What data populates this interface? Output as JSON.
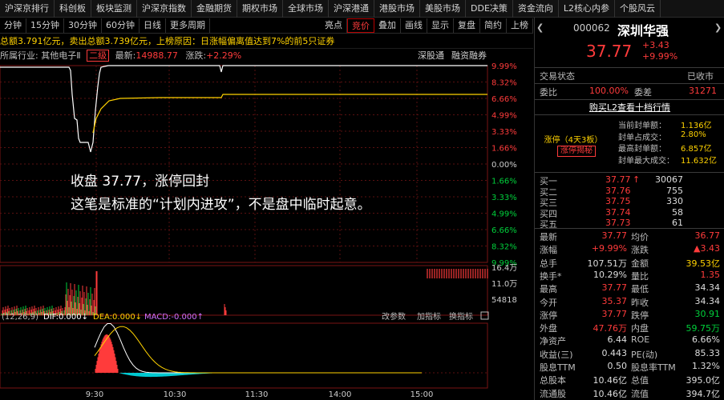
{
  "topnav": [
    "沪深京排行",
    "科创板",
    "板块监测",
    "沪深京指数",
    "金融期货",
    "期权市场",
    "全球市场",
    "沪深港通",
    "港股市场",
    "美股市场",
    "DDE决策",
    "资金流向",
    "L2核心内参",
    "个股风云"
  ],
  "toolbar": {
    "left": [
      "分钟",
      "15分钟",
      "30分钟",
      "60分钟",
      "日线",
      "更多周期"
    ],
    "right": [
      "亮点",
      "竞价",
      "叠加",
      "画线",
      "显示",
      "复盘",
      "简约",
      "上榜"
    ],
    "active": "竞价"
  },
  "status_bar": "总额3.791亿元，卖出总额3.739亿元，上榜原因：日涨幅偏离值达到7%的前5只证券",
  "chart_info": {
    "industry_label": "所属行业:",
    "industry": "其他电子Ⅱ",
    "level": "二级",
    "latest_label": "最新:",
    "latest": "14988.77",
    "change_label": "涨跌:",
    "change": "+2.29%",
    "links": [
      "深股通",
      "融资融券"
    ]
  },
  "price_axis": [
    "9.99%",
    "8.32%",
    "6.66%",
    "4.99%",
    "3.33%",
    "1.66%",
    "0.00%",
    "1.66%",
    "3.33%",
    "4.99%",
    "6.66%",
    "8.32%",
    "9.99%"
  ],
  "volume_axis": [
    "16.4万",
    "11.0万",
    "54818"
  ],
  "overlay": {
    "line1": "收盘 37.77，涨停回封",
    "line2": "这笔是标准的“计划内进攻”，不是盘中临时起意。"
  },
  "macd": {
    "label": "(12,26,9)",
    "dif": "DIF:0.000↓",
    "dea": "DEA:0.000↓",
    "macd": "MACD:-0.000↑",
    "buttons": [
      "改参数",
      "加指标",
      "换指标"
    ]
  },
  "time_axis": [
    "9:30",
    "10:30",
    "11:30",
    "14:00",
    "15:00"
  ],
  "colors": {
    "up": "#ff3b3b",
    "down": "#00d13b",
    "price_line": "#ffffff",
    "avg_line": "#ffd200",
    "macd_neg": "#00c8d0"
  },
  "stock": {
    "code": "000062",
    "name": "深圳华强",
    "price": "37.77",
    "change": "+3.43",
    "change_pct": "+9.99%",
    "trade_state_label": "交易状态",
    "trade_state": "已收市",
    "weibi_label": "委比",
    "weibi": "100.00%",
    "weicha_label": "委差",
    "weicha": "31271",
    "l2_button": "购买L2查看十档行情",
    "limit_stats": [
      {
        "label": "当前封单额：",
        "value": "1.136亿"
      },
      {
        "label": "封单占成交：",
        "value": "2.80%"
      },
      {
        "label": "最高封单额：",
        "value": "6.857亿"
      },
      {
        "label": "封单最大成交：",
        "value": "11.632亿"
      }
    ],
    "limit_title": "涨停（4天3板）",
    "limit_button": "涨停揭秘",
    "bids": [
      {
        "label": "买一",
        "price": "37.77",
        "arrow": "↑",
        "vol": "30067"
      },
      {
        "label": "买二",
        "price": "37.76",
        "arrow": "",
        "vol": "755"
      },
      {
        "label": "买三",
        "price": "37.75",
        "arrow": "",
        "vol": "330"
      },
      {
        "label": "买四",
        "price": "37.74",
        "arrow": "",
        "vol": "58"
      },
      {
        "label": "买五",
        "price": "37.73",
        "arrow": "",
        "vol": "61"
      }
    ],
    "stats": [
      [
        {
          "l": "最新",
          "v": "37.77",
          "c": "r"
        },
        {
          "l": "均价",
          "v": "36.77",
          "c": "r"
        }
      ],
      [
        {
          "l": "涨幅",
          "v": "+9.99%",
          "c": "r"
        },
        {
          "l": "涨跌",
          "v": "▲3.43",
          "c": "r"
        }
      ],
      [
        {
          "l": "总手",
          "v": "107.51万",
          "c": "w"
        },
        {
          "l": "金额",
          "v": "39.53亿",
          "c": "y"
        }
      ],
      [
        {
          "l": "换手*",
          "v": "10.29%",
          "c": "w"
        },
        {
          "l": "量比",
          "v": "1.35",
          "c": "r"
        }
      ],
      [
        {
          "l": "最高",
          "v": "37.77",
          "c": "r"
        },
        {
          "l": "最低",
          "v": "34.34",
          "c": "w"
        }
      ],
      [
        {
          "l": "今开",
          "v": "35.37",
          "c": "r"
        },
        {
          "l": "昨收",
          "v": "34.34",
          "c": "w"
        }
      ],
      [
        {
          "l": "涨停",
          "v": "37.77",
          "c": "r"
        },
        {
          "l": "跌停",
          "v": "30.91",
          "c": "g"
        }
      ],
      [
        {
          "l": "外盘",
          "v": "47.76万",
          "c": "r"
        },
        {
          "l": "内盘",
          "v": "59.75万",
          "c": "g"
        }
      ],
      [
        {
          "l": "净资产",
          "v": "6.44",
          "c": "w"
        },
        {
          "l": "ROE",
          "v": "6.66%",
          "c": "w"
        }
      ],
      [
        {
          "l": "收益(三)",
          "v": "0.443",
          "c": "w"
        },
        {
          "l": "PE(动)",
          "v": "85.33",
          "c": "w"
        }
      ],
      [
        {
          "l": "股息TTM",
          "v": "0.50",
          "c": "w"
        },
        {
          "l": "股息率TTM",
          "v": "1.32%",
          "c": "w"
        }
      ],
      [
        {
          "l": "总股本",
          "v": "10.46亿",
          "c": "w"
        },
        {
          "l": "总值",
          "v": "395.0亿",
          "c": "w"
        }
      ],
      [
        {
          "l": "流通股",
          "v": "10.46亿",
          "c": "w"
        },
        {
          "l": "流值",
          "v": "394.7亿",
          "c": "w"
        }
      ]
    ]
  }
}
